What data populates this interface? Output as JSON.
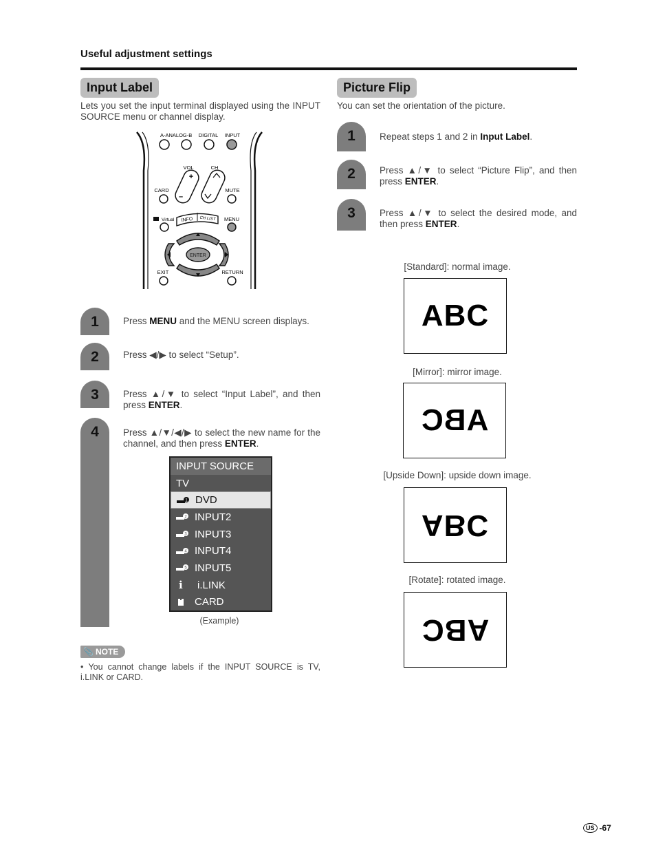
{
  "page": {
    "section_header": "Useful adjustment settings",
    "page_number": "-67",
    "region_badge": "US"
  },
  "input_label": {
    "title": "Input Label",
    "intro": "Lets you set the input terminal displayed using the INPUT SOURCE menu or channel display.",
    "remote": {
      "top_labels": [
        "A-ANALOG-B",
        "DIGITAL",
        "INPUT"
      ],
      "vol_label": "VOL",
      "ch_label": "CH",
      "card_label": "CARD",
      "mute_label": "MUTE",
      "virtual_label": "Virtual",
      "info_label": "INFO",
      "chlist_label": "CH LIST",
      "menu_label": "MENU",
      "enter_label": "ENTER",
      "exit_label": "EXIT",
      "return_label": "RETURN"
    },
    "steps": [
      {
        "num": "1",
        "pre": "Press ",
        "bold": "MENU",
        "post": " and the MENU screen displays."
      },
      {
        "num": "2",
        "pre": "Press ◀/▶ to select “Setup”.",
        "bold": "",
        "post": ""
      },
      {
        "num": "3",
        "pre": "Press ▲/▼ to select “Input Label”, and then press ",
        "bold": "ENTER",
        "post": "."
      },
      {
        "num": "4",
        "pre": "Press ▲/▼/◀/▶ to select the new name for the channel, and then press ",
        "bold": "ENTER",
        "post": "."
      }
    ],
    "menu": {
      "header": "INPUT SOURCE",
      "items": [
        {
          "label": "TV",
          "icon": "none"
        },
        {
          "label": "DVD",
          "icon": "input-1-icon",
          "selected": true
        },
        {
          "label": "INPUT2",
          "icon": "input-2-icon"
        },
        {
          "label": "INPUT3",
          "icon": "input-3-icon"
        },
        {
          "label": "INPUT4",
          "icon": "input-4-icon"
        },
        {
          "label": "INPUT5",
          "icon": "input-5-icon"
        },
        {
          "label": "i.LINK",
          "icon": "ilink-icon"
        },
        {
          "label": "CARD",
          "icon": "card-icon"
        }
      ],
      "caption": "(Example)"
    },
    "note": {
      "badge": "NOTE",
      "text": "You cannot change labels if the INPUT SOURCE is TV, i.LINK or CARD."
    }
  },
  "picture_flip": {
    "title": "Picture Flip",
    "intro": "You can set the orientation of the picture.",
    "steps": [
      {
        "num": "1",
        "pre": "Repeat steps 1 and 2 in ",
        "bold": "Input Label",
        "post": "."
      },
      {
        "num": "2",
        "pre": "Press ▲/▼ to select “Picture Flip”, and then press ",
        "bold": "ENTER",
        "post": "."
      },
      {
        "num": "3",
        "pre": "Press ▲/▼ to select the desired mode, and then press ",
        "bold": "ENTER",
        "post": "."
      }
    ],
    "modes": [
      {
        "caption": "[Standard]: normal image.",
        "sample": "ABC",
        "transform": "standard"
      },
      {
        "caption": "[Mirror]: mirror image.",
        "sample": "ABC",
        "transform": "mirror"
      },
      {
        "caption": "[Upside Down]: upside down image.",
        "sample": "ABC",
        "transform": "upside-down"
      },
      {
        "caption": "[Rotate]: rotated image.",
        "sample": "ABC",
        "transform": "rotate"
      }
    ]
  }
}
